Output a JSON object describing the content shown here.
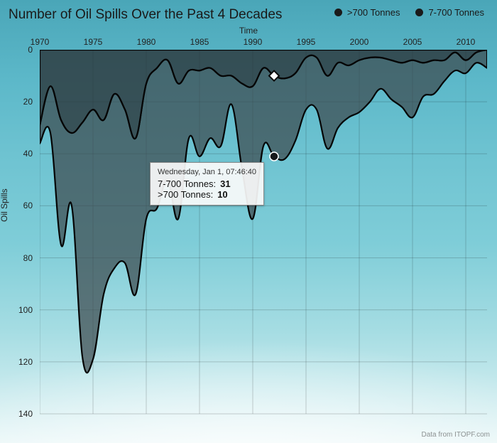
{
  "title": "Number of Oil Spills Over the Past 4 Decades",
  "legend": {
    "a": ">700 Tonnes",
    "b": "7-700 Tonnes"
  },
  "xaxis_title": "Time",
  "yaxis_title": "Oil Spills",
  "credit": "Data from ITOPF.com",
  "tooltip": {
    "header": "Wednesday, Jan 1, 07:46:40",
    "row1_label": "7-700 Tonnes:",
    "row1_value": "31",
    "row2_label": ">700 Tonnes:",
    "row2_value": "10",
    "year": 1992
  },
  "chart_data": {
    "type": "area",
    "stacked": true,
    "orientation": "inverted-y",
    "xlabel": "Time",
    "ylabel": "Oil Spills",
    "title": "Number of Oil Spills Over the Past 4 Decades",
    "xlim": [
      1970,
      2012
    ],
    "ylim": [
      0,
      140
    ],
    "y_inverted": true,
    "x_ticks": [
      1970,
      1975,
      1980,
      1985,
      1990,
      1995,
      2000,
      2005,
      2010
    ],
    "y_ticks": [
      0,
      20,
      40,
      60,
      80,
      100,
      120,
      140
    ],
    "x": [
      1970,
      1971,
      1972,
      1973,
      1974,
      1975,
      1976,
      1977,
      1978,
      1979,
      1980,
      1981,
      1982,
      1983,
      1984,
      1985,
      1986,
      1987,
      1988,
      1989,
      1990,
      1991,
      1992,
      1993,
      1994,
      1995,
      1996,
      1997,
      1998,
      1999,
      2000,
      2001,
      2002,
      2003,
      2004,
      2005,
      2006,
      2007,
      2008,
      2009,
      2010,
      2011,
      2012
    ],
    "series": [
      {
        "name": ">700 Tonnes",
        "values": [
          29,
          14,
          27,
          32,
          28,
          23,
          27,
          17,
          23,
          34,
          13,
          7,
          4,
          13,
          8,
          8,
          7,
          10,
          10,
          13,
          14,
          7,
          10,
          11,
          9,
          3,
          3,
          10,
          5,
          6,
          4,
          3,
          3,
          4,
          5,
          4,
          5,
          4,
          4,
          1,
          4,
          1,
          0
        ]
      },
      {
        "name": "7-700 Tonnes",
        "values": [
          7,
          18,
          48,
          28,
          90,
          96,
          67,
          67,
          59,
          60,
          52,
          54,
          46,
          52,
          26,
          33,
          27,
          27,
          11,
          33,
          51,
          30,
          31,
          31,
          26,
          20,
          20,
          28,
          25,
          20,
          20,
          17,
          12,
          15,
          17,
          22,
          13,
          13,
          8,
          7,
          5,
          4,
          7
        ]
      }
    ],
    "tooltip_sample": {
      "year": 1992,
      "7-700 Tonnes": 31,
      ">700 Tonnes": 10
    }
  }
}
